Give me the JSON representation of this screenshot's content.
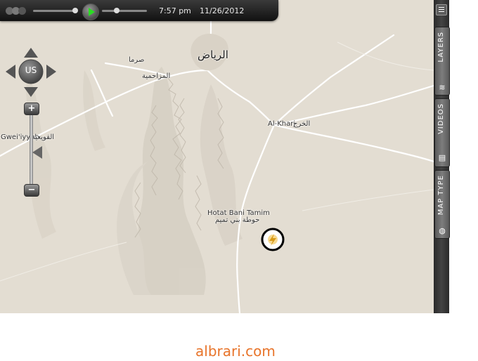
{
  "player": {
    "time": "7:57 pm",
    "date": "11/26/2012"
  },
  "nav": {
    "region": "US",
    "zoom_in": "+",
    "zoom_out": "−"
  },
  "side_panel": {
    "menu_icon": "menu-icon",
    "buttons": [
      {
        "label": "LAYERS",
        "icon": "layers-icon"
      },
      {
        "label": "VIDEOS",
        "icon": "film-icon"
      },
      {
        "label": "MAP TYPE",
        "icon": "globe-icon"
      }
    ]
  },
  "map": {
    "labels": {
      "riyadh": "الرياض",
      "sarma": "صرما",
      "muzahimiyah": "المزاحمية",
      "quwayiyah_en": "Gwei'iyyah",
      "quwayiyah_ar": "القويعية",
      "alkharj": "Al-Kharj",
      "alkharj_ar": "الخرج",
      "hotat_en": "Hotat Bani Tamim",
      "hotat_ar": "حوطة بني تميم"
    },
    "marker_icon": "lightning-icon"
  },
  "credit": "albrari.com",
  "colors": {
    "land": "#e3ddd2",
    "roads": "#ffffff",
    "panel": "#333333",
    "play": "#2bdc24",
    "credit": "#e8742a"
  }
}
